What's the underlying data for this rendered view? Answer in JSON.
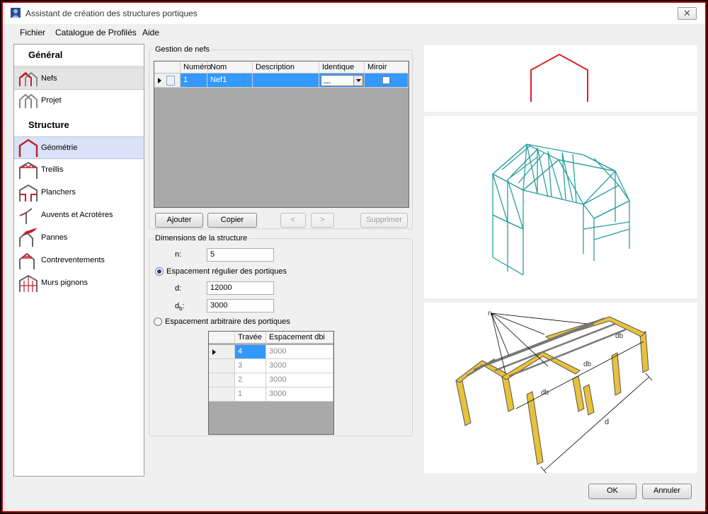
{
  "window": {
    "title": "Assistant de création des structures portiques",
    "close_symbol": "✕"
  },
  "menu": {
    "items": [
      "Fichier",
      "Catalogue de Profilés",
      "Aide"
    ]
  },
  "nav": {
    "general_header": "Général",
    "structure_header": "Structure",
    "general_items": [
      {
        "label": "Nefs",
        "icon": "nave-frame-icon"
      },
      {
        "label": "Projet",
        "icon": "project-frame-icon"
      }
    ],
    "structure_items": [
      {
        "label": "Géométrie",
        "icon": "geometry-portal-icon"
      },
      {
        "label": "Treillis",
        "icon": "truss-icon"
      },
      {
        "label": "Planchers",
        "icon": "floor-icon"
      },
      {
        "label": "Auvents et Acrotères",
        "icon": "canopy-icon"
      },
      {
        "label": "Pannes",
        "icon": "purlin-icon"
      },
      {
        "label": "Contreventements",
        "icon": "bracing-icon"
      },
      {
        "label": "Murs pignons",
        "icon": "gable-wall-icon"
      }
    ]
  },
  "nefs": {
    "group_title": "Gestion de nefs",
    "columns": [
      "Numéro",
      "Nom",
      "Description",
      "Identique",
      "Miroir"
    ],
    "rows": [
      {
        "number": "1",
        "name": "Nef1",
        "description": "",
        "identique": "---",
        "miroir": false
      }
    ],
    "buttons": {
      "add": "Ajouter",
      "copy": "Copier",
      "prev": "<",
      "next": ">",
      "delete": "Supprimer"
    }
  },
  "dimensions": {
    "group_title": "Dimensions de la structure",
    "n_label": "n:",
    "n_value": "5",
    "regular_label": "Espacement régulier des portiques",
    "d_label": "d:",
    "d_value": "12000",
    "db_label_main": "d",
    "db_label_sub": "b",
    "db_label_colon": ":",
    "db_value": "3000",
    "arbitrary_label": "Espacement arbitraire des portiques",
    "spacing_columns": [
      "Travée",
      "Espacement dbi"
    ],
    "spacing_rows": [
      {
        "bay": "4",
        "spacing": "3000"
      },
      {
        "bay": "3",
        "spacing": "3000"
      },
      {
        "bay": "2",
        "spacing": "3000"
      },
      {
        "bay": "1",
        "spacing": "3000"
      }
    ]
  },
  "preview": {
    "diagram_labels": {
      "n": "n",
      "db": "db",
      "d": "d"
    }
  },
  "footer": {
    "ok": "OK",
    "cancel": "Annuler"
  },
  "colors": {
    "accent_red": "#e0202a",
    "model_teal": "#2a9fa0",
    "member_yellow": "#e8c23a",
    "selection_blue": "#3399ff"
  }
}
